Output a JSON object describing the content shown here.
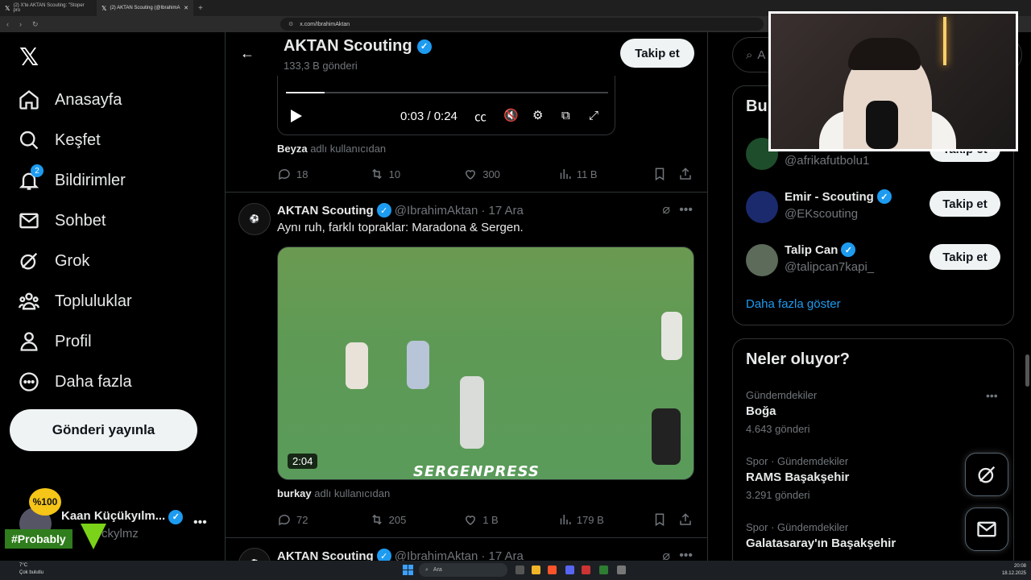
{
  "browser": {
    "tabs": [
      {
        "label": "(2) X'te AKTAN Scouting: \"Stoper pro"
      },
      {
        "label": "(2) AKTAN Scouting (@IbrahimA"
      }
    ],
    "url": "x.com/IbrahimAktan"
  },
  "nav": {
    "items": [
      {
        "label": "Anasayfa"
      },
      {
        "label": "Keşfet"
      },
      {
        "label": "Bildirimler",
        "badge": "2"
      },
      {
        "label": "Sohbet"
      },
      {
        "label": "Grok"
      },
      {
        "label": "Topluluklar"
      },
      {
        "label": "Profil"
      },
      {
        "label": "Daha fazla"
      }
    ],
    "post_button": "Gönderi yayınla",
    "account": {
      "name": "Kaan Küçükyılm...",
      "handle": "ckylmz"
    }
  },
  "overlay": {
    "badge": "%100",
    "hashtag": "#Probably"
  },
  "header": {
    "title": "AKTAN Scouting",
    "subtitle": "133,3 B gönderi",
    "follow": "Takip et"
  },
  "player": {
    "time": "0:03 / 0:24",
    "progress": 0.12
  },
  "tweet1": {
    "note_user": "Beyza",
    "note_suffix": "adlı kullanıcıdan",
    "replies": "18",
    "reposts": "10",
    "likes": "300",
    "views": "11 B"
  },
  "tweet2": {
    "name": "AKTAN Scouting",
    "handle": "@IbrahimAktan",
    "date": "· 17 Ara",
    "text": "Aynı ruh, farklı topraklar: Maradona & Sergen.",
    "video_duration": "2:04",
    "watermark": "SERGENPRESS",
    "note_user": "burkay",
    "note_suffix": "adlı kullanıcıdan",
    "replies": "72",
    "reposts": "205",
    "likes": "1 B",
    "views": "179 B"
  },
  "tweet3": {
    "name": "AKTAN Scouting",
    "handle": "@IbrahimAktan",
    "date": "· 17 Ara"
  },
  "right": {
    "search_placeholder": "A",
    "who_to_follow_title": "Bu",
    "accounts": [
      {
        "name": "",
        "handle": "@afrikafutbolu1",
        "button": "Takip et"
      },
      {
        "name": "Emir - Scouting",
        "handle": "@EKscouting",
        "button": "Takip et"
      },
      {
        "name": "Talip Can",
        "handle": "@talipcan7kapi_",
        "button": "Takip et"
      }
    ],
    "show_more": "Daha fazla göster",
    "trends_title": "Neler oluyor?",
    "trends": [
      {
        "meta": "Gündemdekiler",
        "name": "Boğa",
        "count": "4.643 gönderi"
      },
      {
        "meta": "Spor · Gündemdekiler",
        "name": "RAMS Başakşehir",
        "count": "3.291 gönderi"
      },
      {
        "meta": "Spor · Gündemdekiler",
        "name": "Galatasaray'ın Başakşehir",
        "count": ""
      }
    ]
  },
  "taskbar": {
    "weather_temp": "7°C",
    "weather_desc": "Çok bulutlu",
    "search": "Ara",
    "time": "20:08",
    "date": "18.12.2025"
  },
  "colors": {
    "accent": "#1d9bf0",
    "background": "#000000",
    "border": "#2f3336"
  }
}
